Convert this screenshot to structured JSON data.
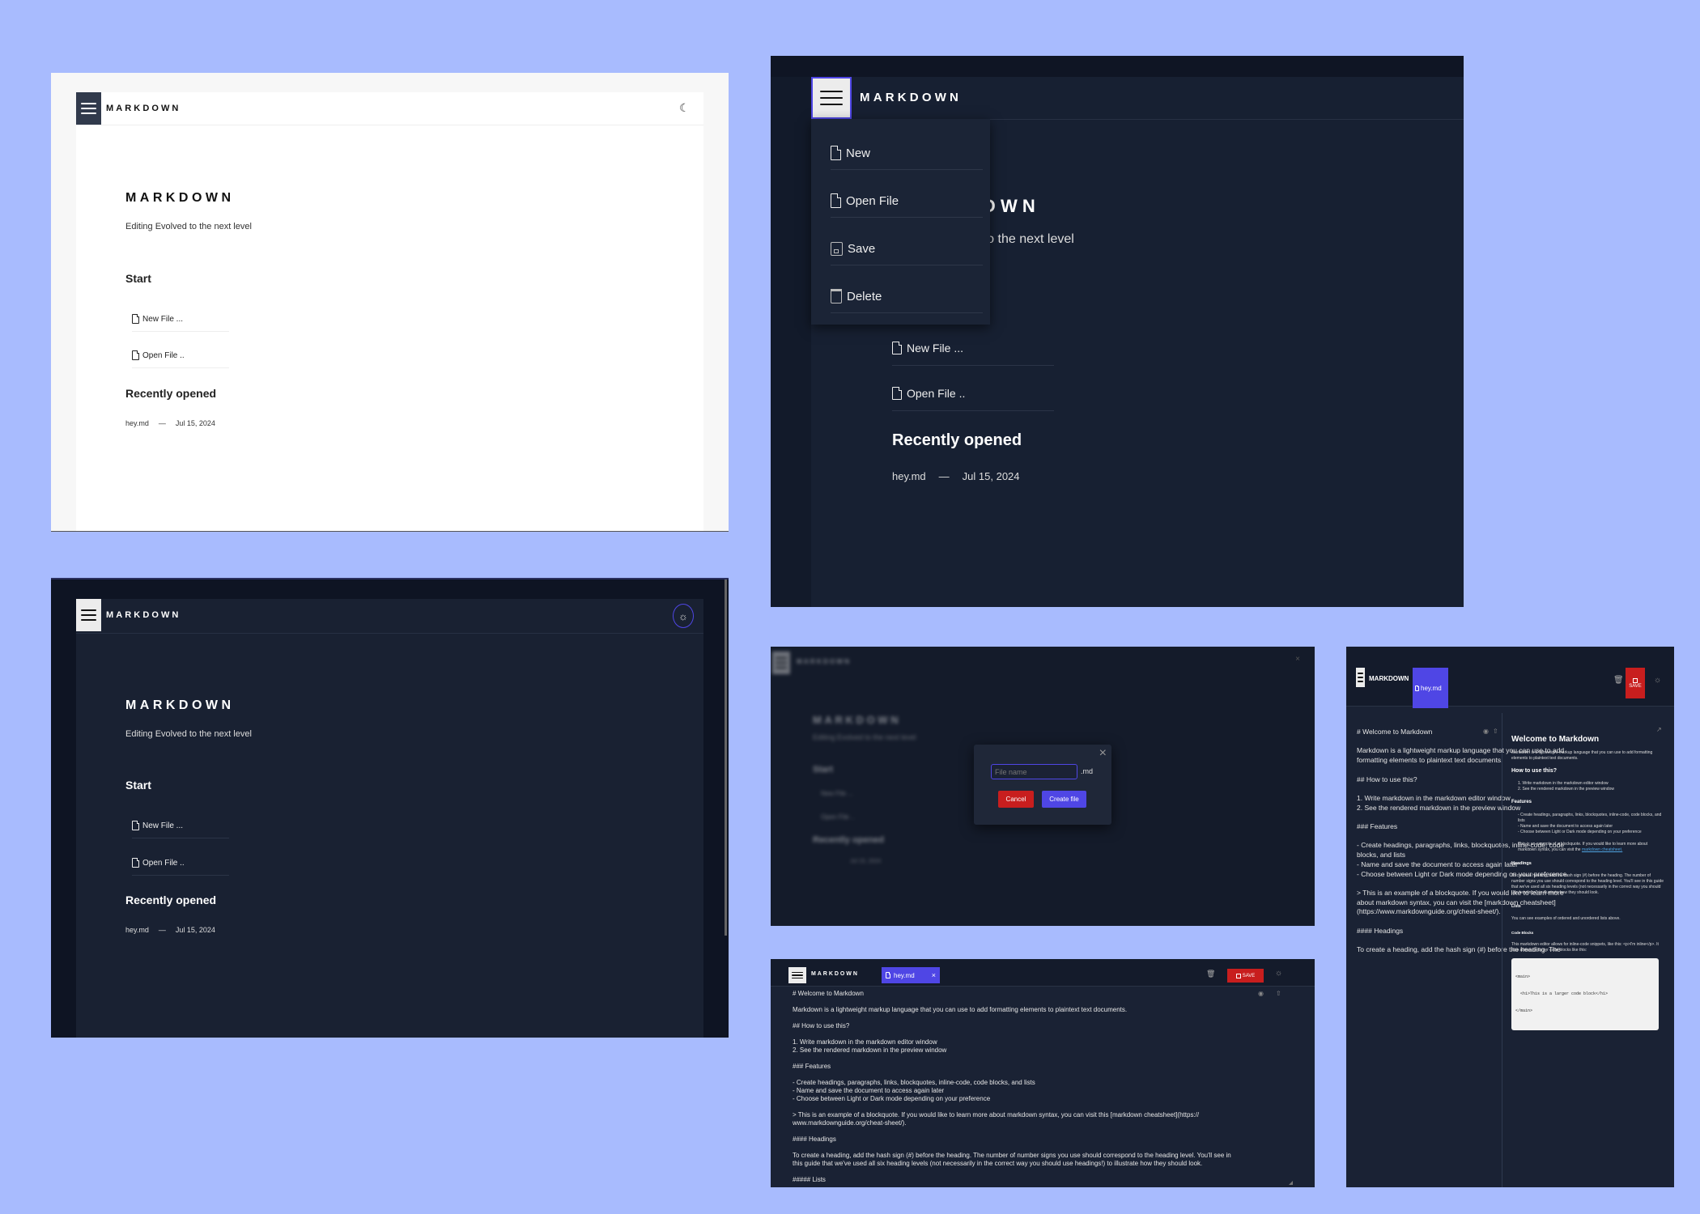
{
  "app": {
    "brand": "MARKDOWN",
    "hero_title": "MARKDOWN",
    "tagline": "Editing Evolved to the next level",
    "start_heading": "Start",
    "new_file": "New File ...",
    "open_file": "Open File ..",
    "recent_heading": "Recently opened",
    "recent_file": "hey.md",
    "recent_sep": "—",
    "recent_date": "Jul 15, 2024"
  },
  "menu": {
    "items": [
      "New",
      "Open File",
      "Save",
      "Delete"
    ]
  },
  "dialog": {
    "placeholder": "File name",
    "ext": ".md",
    "cancel": "Cancel",
    "create": "Create file"
  },
  "editor": {
    "tab": "hey.md",
    "tab_close": "×",
    "save": "SAVE",
    "lines": [
      "# Welcome to Markdown",
      "",
      "Markdown is a lightweight markup language that you can use to add formatting elements to plaintext text documents.",
      "",
      "## How to use this?",
      "",
      "1. Write markdown in the markdown editor window",
      "2. See the rendered markdown in the preview window",
      "",
      "### Features",
      "",
      "- Create headings, paragraphs, links, blockquotes, inline-code, code blocks, and lists",
      "- Name and save the document to access again later",
      "- Choose between Light or Dark mode depending on your preference",
      "",
      "> This is an example of a blockquote. If you would like to learn more about markdown syntax, you can visit this [markdown cheatsheet](https://",
      "www.markdownguide.org/cheat-sheet/).",
      "",
      "#### Headings",
      "",
      "To create a heading, add the hash sign (#) before the heading. The number of number signs you use should correspond to the heading level. You'll see in",
      "this guide that we've used all six heading levels (not necessarily in the correct way you should use headings!) to illustrate how they should look.",
      "",
      "##### Lists"
    ],
    "narrow_lines": [
      "# Welcome to Markdown",
      "",
      "Markdown is a lightweight markup language that you can use to add",
      "formatting elements to plaintext text documents.",
      "",
      "## How to use this?",
      "",
      "1. Write markdown in the markdown editor window",
      "2. See the rendered markdown in the preview window",
      "",
      "### Features",
      "",
      "- Create headings, paragraphs, links, blockquotes, inline-code, code",
      "blocks, and lists",
      "- Name and save the document to access again later",
      "- Choose between Light or Dark mode depending on your preference",
      "",
      "> This is an example of a blockquote. If you would like to learn more",
      "about markdown syntax, you can visit the [markdown cheatsheet]",
      "(https://www.markdownguide.org/cheat-sheet/).",
      "",
      "#### Headings",
      "",
      "To create a heading, add the hash sign (#) before the heading. The"
    ]
  },
  "preview": {
    "h1": "Welcome to Markdown",
    "p1": "Markdown is a lightweight markup language that you can use to add formatting elements to plaintext text documents.",
    "h2": "How to use this?",
    "ol": [
      "1. Write markdown in the markdown editor window",
      "2. See the rendered markdown in the preview window"
    ],
    "h3": "Features",
    "ul": [
      "- Create headings, paragraphs, links, blockquotes, inline-code, code blocks, and lists",
      "- Name and save the document to access again later",
      "- Choose between Light or Dark mode depending on your preference"
    ],
    "quote": "This is an example of a blockquote. If you would like to learn more about markdown syntax, you can visit the",
    "quote_link": "markdown cheatsheet.",
    "h4": "Headings",
    "p2": "To create a heading, add the hash sign (#) before the heading. The number of number signs you use should correspond to the heading level. You'll see in this guide that we've used all six heading levels (not necessarily in the correct way you should use headings!) to illustrate how they should look.",
    "h5": "Lists",
    "p3": "You can see examples of ordered and unordered lists above.",
    "h6": "Code Blocks",
    "p4": "This markdown editor allows for inline-code snippets, like this: <p>I'm inline</p>. It also allows for larger code blocks like this:",
    "code": [
      "<main>",
      "  <h1>This is a larger code block</h1>",
      "</main>"
    ]
  },
  "colors": {
    "page_bg": "#a8bbfe",
    "dark_bg": "#121a2a",
    "accent": "#4f46e5",
    "danger": "#c81e1e"
  }
}
